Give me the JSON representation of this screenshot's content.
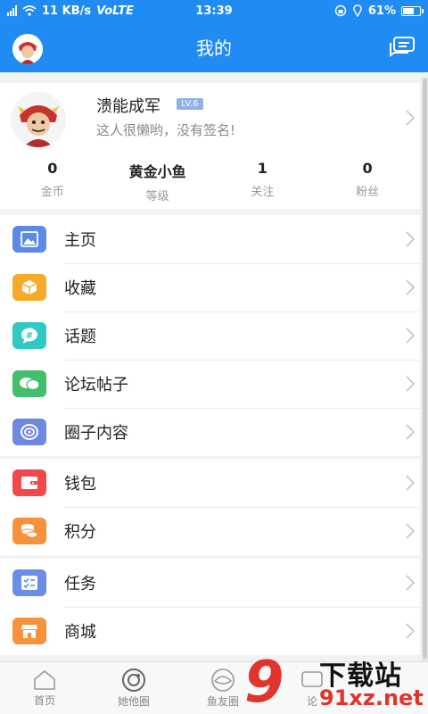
{
  "status_bar": {
    "network": "11 KB/s",
    "volte": "VoLTE",
    "time": "13:39",
    "battery": "61%",
    "battery_level": 0.61
  },
  "app_bar": {
    "title": "我的"
  },
  "profile": {
    "username": "溃能成军",
    "level": "LV.6",
    "signature": "这人很懒哟，没有签名!",
    "stats": [
      {
        "value": "0",
        "label": "金币"
      },
      {
        "value": "黄金小鱼",
        "label": "等级"
      },
      {
        "value": "1",
        "label": "关注"
      },
      {
        "value": "0",
        "label": "粉丝"
      }
    ]
  },
  "menu_groups": [
    [
      {
        "label": "主页",
        "icon": "image-icon",
        "color": "#5b8be6"
      },
      {
        "label": "收藏",
        "icon": "box-icon",
        "color": "#f7a928"
      },
      {
        "label": "话题",
        "icon": "hashtag-bubble-icon",
        "color": "#31c9c3"
      },
      {
        "label": "论坛帖子",
        "icon": "chat-bubbles-icon",
        "color": "#43be6a"
      },
      {
        "label": "圈子内容",
        "icon": "circle-swirl-icon",
        "color": "#6f87e0"
      }
    ],
    [
      {
        "label": "钱包",
        "icon": "wallet-icon",
        "color": "#f0484c"
      },
      {
        "label": "积分",
        "icon": "coins-icon",
        "color": "#f7913a"
      }
    ],
    [
      {
        "label": "任务",
        "icon": "task-list-icon",
        "color": "#6a8de6"
      },
      {
        "label": "商城",
        "icon": "store-icon",
        "color": "#f7913a"
      }
    ]
  ],
  "bottom_nav": [
    {
      "label": "首页",
      "icon": "home-icon"
    },
    {
      "label": "她他圈",
      "icon": "ring-icon"
    },
    {
      "label": "鱼友圈",
      "icon": "eye-circle-icon"
    },
    {
      "label": "论",
      "icon": "forum-icon"
    }
  ],
  "watermark": {
    "digit": "9",
    "text": "下载站",
    "url": "91xz.net"
  }
}
